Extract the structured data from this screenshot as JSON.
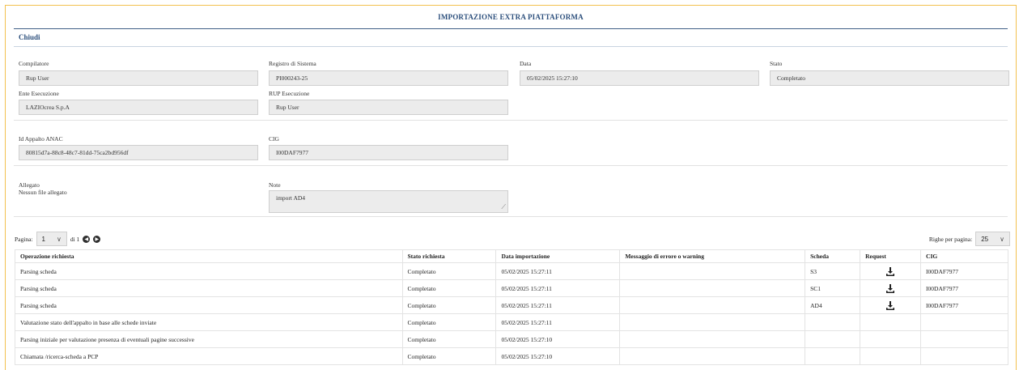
{
  "header": {
    "title": "IMPORTAZIONE EXTRA PIATTAFORMA",
    "close_label": "Chiudi"
  },
  "fields": {
    "compilatore": {
      "label": "Compilatore",
      "value": "Rup User"
    },
    "registro": {
      "label": "Registro di Sistema",
      "value": "PI000243-25"
    },
    "data": {
      "label": "Data",
      "value": "05/02/2025 15:27:10"
    },
    "stato": {
      "label": "Stato",
      "value": "Completato"
    },
    "ente": {
      "label": "Ente Esecuzione",
      "value": "LAZIOcrea S.p.A"
    },
    "rup": {
      "label": "RUP Esecuzione",
      "value": "Rup User"
    },
    "id_appalto": {
      "label": "Id Appalto ANAC",
      "value": "80815d7a-88c8-48c7-81dd-75ca2bd956df"
    },
    "cig": {
      "label": "CIG",
      "value": "I00DAF7977"
    },
    "allegato": {
      "label": "Allegato",
      "value": "Nessun file allegato"
    },
    "note": {
      "label": "Note",
      "value": "import AD4"
    }
  },
  "pagination": {
    "page_label": "Pagina:",
    "page_value": "1",
    "of_label": "di 1",
    "rows_label": "Righe per pagina:",
    "rows_value": "25"
  },
  "table": {
    "headers": [
      "Operazione richiesta",
      "Stato richiesta",
      "Data importazione",
      "Messaggio di errore o warning",
      "Scheda",
      "Request",
      "CIG"
    ],
    "rows": [
      {
        "op": "Parsing scheda",
        "stato": "Completato",
        "data": "05/02/2025 15:27:11",
        "msg": "",
        "scheda": "S3",
        "request": "download-icon",
        "cig": "I00DAF7977"
      },
      {
        "op": "Parsing scheda",
        "stato": "Completato",
        "data": "05/02/2025 15:27:11",
        "msg": "",
        "scheda": "SC1",
        "request": "download-icon",
        "cig": "I00DAF7977"
      },
      {
        "op": "Parsing scheda",
        "stato": "Completato",
        "data": "05/02/2025 15:27:11",
        "msg": "",
        "scheda": "AD4",
        "request": "download-icon",
        "cig": "I00DAF7977"
      },
      {
        "op": "Valutazione stato dell'appalto in base alle schede inviate",
        "stato": "Completato",
        "data": "05/02/2025 15:27:11",
        "msg": "",
        "scheda": "",
        "request": "",
        "cig": ""
      },
      {
        "op": "Parsing iniziale per valutazione presenza di eventuali pagine successive",
        "stato": "Completato",
        "data": "05/02/2025 15:27:10",
        "msg": "",
        "scheda": "",
        "request": "",
        "cig": ""
      },
      {
        "op": "Chiamata /ricerca-scheda a PCP",
        "stato": "Completato",
        "data": "05/02/2025 15:27:10",
        "msg": "",
        "scheda": "",
        "request": "",
        "cig": ""
      }
    ]
  },
  "colors": {
    "accent": "#2c4f7c",
    "frame": "#f2c14e"
  }
}
